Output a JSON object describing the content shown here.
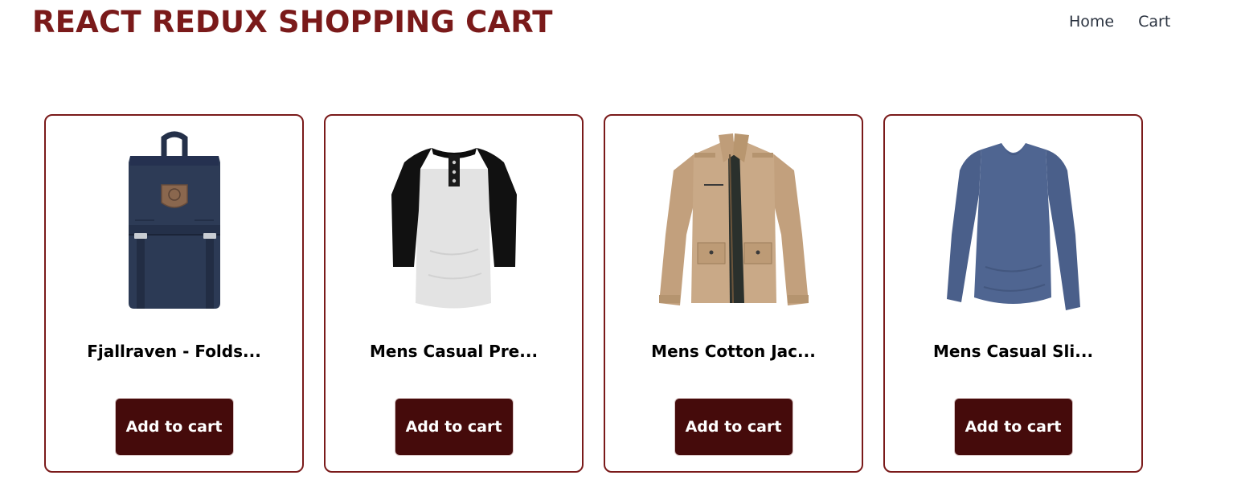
{
  "header": {
    "brand": "REACT REDUX SHOPPING CART",
    "nav": {
      "home": "Home",
      "cart": "Cart"
    }
  },
  "products": [
    {
      "title": "Fjallraven - Folds...",
      "button": "Add to cart",
      "image": "navy-backpack",
      "color": "#2c3a55"
    },
    {
      "title": "Mens Casual Pre...",
      "button": "Add to cart",
      "image": "raglan-henley-tee",
      "color": "#e3e3e3"
    },
    {
      "title": "Mens Cotton Jac...",
      "button": "Add to cart",
      "image": "khaki-cotton-jacket",
      "color": "#c9a987"
    },
    {
      "title": "Mens Casual Sli...",
      "button": "Add to cart",
      "image": "blue-long-sleeve-tee",
      "color": "#4f6591"
    }
  ],
  "colors": {
    "brand": "#7a1a1a",
    "button_bg": "#450b0b",
    "card_border": "#7a1a1a"
  }
}
